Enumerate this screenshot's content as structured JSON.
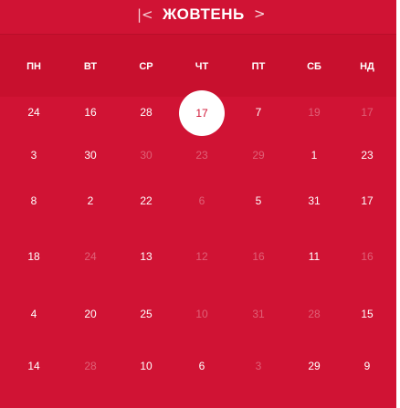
{
  "header": {
    "prev_label": "|<",
    "month": "ЖОВТЕНЬ",
    "next_label": ">"
  },
  "weekdays": [
    "ПН",
    "ВТ",
    "СР",
    "ЧТ",
    "ПТ",
    "СБ",
    "НД"
  ],
  "rows": [
    [
      {
        "t": "24",
        "dim": false
      },
      {
        "t": "16",
        "dim": false
      },
      {
        "t": "28",
        "dim": false
      },
      {
        "t": "17",
        "dim": false,
        "today": true
      },
      {
        "t": "7",
        "dim": false
      },
      {
        "t": "19",
        "dim": true
      },
      {
        "t": "17",
        "dim": true
      }
    ],
    [
      {
        "t": "3",
        "dim": false
      },
      {
        "t": "30",
        "dim": false
      },
      {
        "t": "30",
        "dim": true
      },
      {
        "t": "23",
        "dim": true
      },
      {
        "t": "29",
        "dim": true
      },
      {
        "t": "1",
        "dim": false
      },
      {
        "t": "23",
        "dim": false
      }
    ],
    [
      {
        "t": "8",
        "dim": false
      },
      {
        "t": "2",
        "dim": false
      },
      {
        "t": "22",
        "dim": false
      },
      {
        "t": "6",
        "dim": true
      },
      {
        "t": "5",
        "dim": false
      },
      {
        "t": "31",
        "dim": false
      },
      {
        "t": "17",
        "dim": false
      }
    ],
    [
      {
        "t": "18",
        "dim": false
      },
      {
        "t": "24",
        "dim": true
      },
      {
        "t": "13",
        "dim": false
      },
      {
        "t": "12",
        "dim": true
      },
      {
        "t": "16",
        "dim": true
      },
      {
        "t": "11",
        "dim": false
      },
      {
        "t": "16",
        "dim": true
      }
    ],
    [
      {
        "t": "4",
        "dim": false
      },
      {
        "t": "20",
        "dim": false
      },
      {
        "t": "25",
        "dim": false
      },
      {
        "t": "10",
        "dim": true
      },
      {
        "t": "31",
        "dim": true
      },
      {
        "t": "28",
        "dim": true
      },
      {
        "t": "15",
        "dim": false
      }
    ],
    [
      {
        "t": "14",
        "dim": false
      },
      {
        "t": "28",
        "dim": true
      },
      {
        "t": "10",
        "dim": false
      },
      {
        "t": "6",
        "dim": false
      },
      {
        "t": "3",
        "dim": true
      },
      {
        "t": "29",
        "dim": false
      },
      {
        "t": "9",
        "dim": false
      }
    ]
  ],
  "colors": {
    "background": "#d01334",
    "weekday_band": "#c8102e",
    "today_circle": "#ffffff"
  }
}
